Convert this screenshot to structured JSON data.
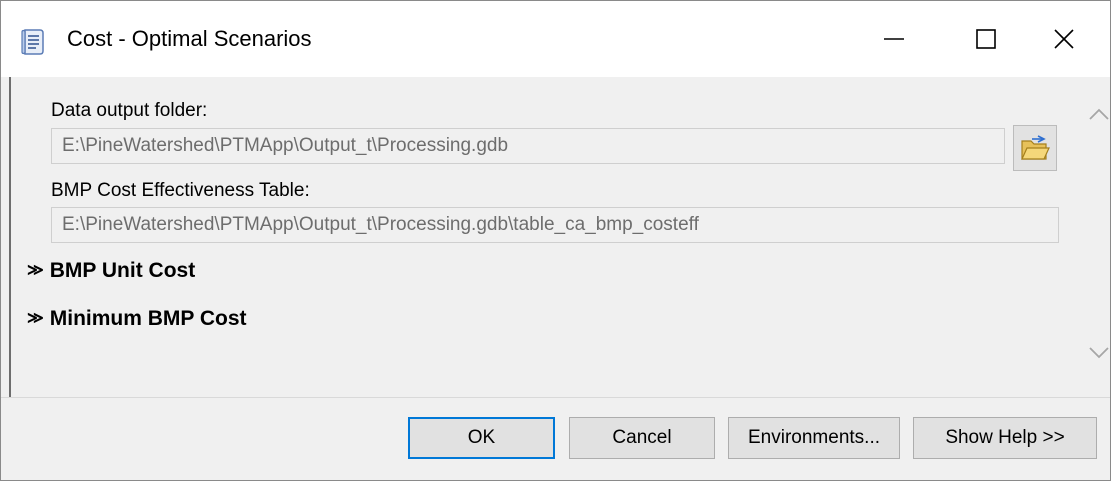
{
  "window": {
    "title": "Cost - Optimal Scenarios",
    "controls": {
      "minimize": "—",
      "maximize": "☐",
      "close": "✕"
    }
  },
  "form": {
    "output_folder": {
      "label": "Data output folder:",
      "value": "E:\\PineWatershed\\PTMApp\\Output_t\\Processing.gdb"
    },
    "cost_table": {
      "label": "BMP Cost Effectiveness Table:",
      "value": "E:\\PineWatershed\\PTMApp\\Output_t\\Processing.gdb\\table_ca_bmp_costeff"
    },
    "sections": [
      {
        "label": "BMP Unit Cost",
        "state": "collapsed"
      },
      {
        "label": "Minimum BMP Cost",
        "state": "collapsed"
      }
    ]
  },
  "buttons": {
    "ok": "OK",
    "cancel": "Cancel",
    "environments": "Environments...",
    "show_help": "Show Help >>"
  },
  "icons": {
    "app": "script-tool-icon",
    "browse": "folder-open-icon",
    "section_toggle": "double-chevron-down-icon",
    "scroll_up": "chevron-up-icon",
    "scroll_down": "chevron-down-icon"
  },
  "colors": {
    "focus_border": "#0078d7",
    "panel_bg": "#f0f0f0",
    "disabled_text": "#6d6d6d"
  }
}
